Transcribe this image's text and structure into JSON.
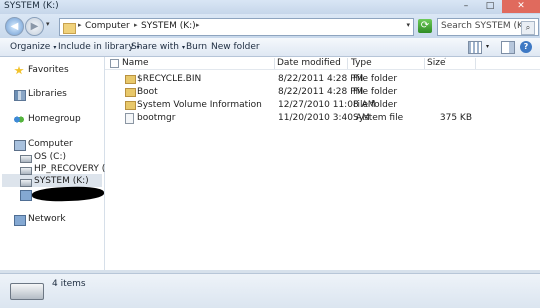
{
  "window": {
    "title": "SYSTEM (K:)",
    "controls": {
      "minimize": "–",
      "maximize": "□",
      "close": "✕"
    }
  },
  "navigation": {
    "back_glyph": "◀",
    "forward_glyph": "▶",
    "history_glyph": "▾",
    "address": {
      "separator_glyph": "▸",
      "segments": [
        "Computer",
        "SYSTEM (K:)"
      ],
      "dropdown_glyph": "▾"
    },
    "refresh_glyph": "⟳",
    "search": {
      "placeholder": "Search SYSTEM (K:)",
      "icon_glyph": "⌕"
    }
  },
  "toolbar": {
    "organize": "Organize",
    "include_in_library": "Include in library",
    "share_with": "Share with",
    "burn": "Burn",
    "new_folder": "New folder",
    "dropdown_glyph": "▾",
    "help_glyph": "?"
  },
  "sidebar": {
    "favorites": "Favorites",
    "libraries": "Libraries",
    "homegroup": "Homegroup",
    "computer": "Computer",
    "drives": [
      "OS (C:)",
      "HP_RECOVERY (D:)",
      "SYSTEM (K:)"
    ],
    "network": "Network"
  },
  "file_list": {
    "columns": {
      "name": "Name",
      "date_modified": "Date modified",
      "type": "Type",
      "size": "Size",
      "sort_glyph": "˄"
    },
    "rows": [
      {
        "name": "$RECYCLE.BIN",
        "date": "8/22/2011 4:28 PM",
        "type": "File folder",
        "size": ""
      },
      {
        "name": "Boot",
        "date": "8/22/2011 4:28 PM",
        "type": "File folder",
        "size": ""
      },
      {
        "name": "System Volume Information",
        "date": "12/27/2010 11:08 AM",
        "type": "File folder",
        "size": ""
      },
      {
        "name": "bootmgr",
        "date": "11/20/2010 3:40 AM",
        "type": "System file",
        "size": "375 KB"
      }
    ]
  },
  "details": {
    "item_count": "4 items"
  }
}
